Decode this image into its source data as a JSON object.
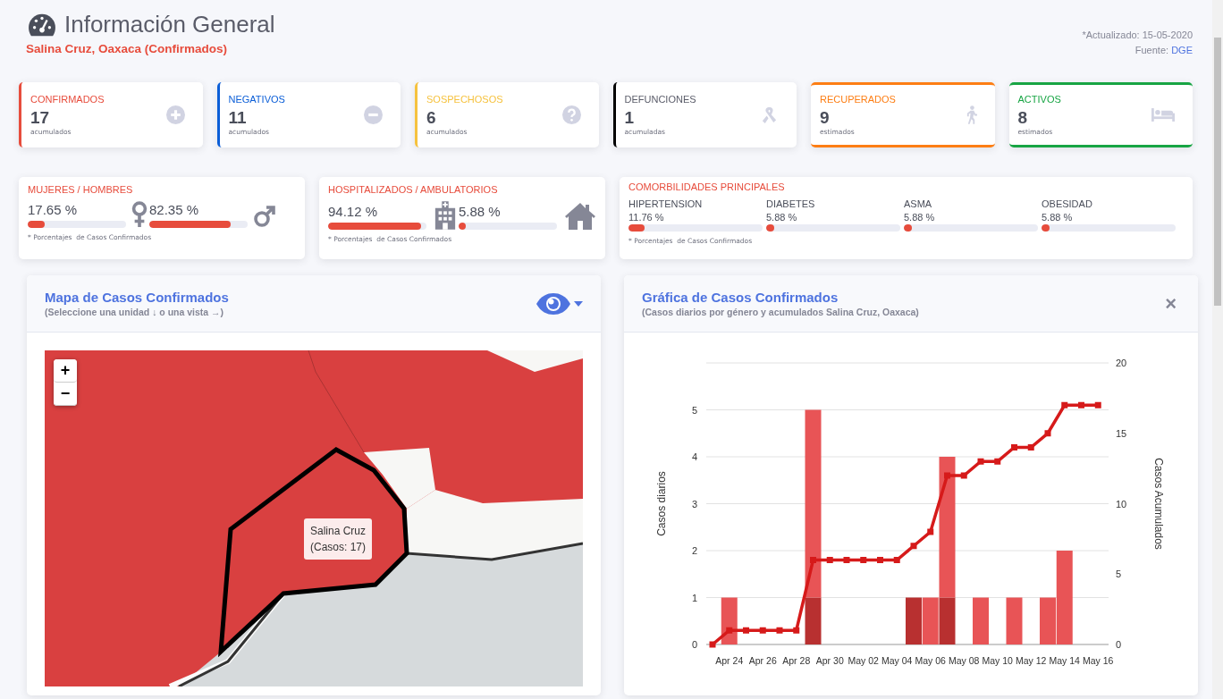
{
  "header": {
    "title": "Información General",
    "subtitle": "Salina Cruz, Oaxaca (Confirmados)",
    "updated": "*Actualizado: 15-05-2020",
    "source_label": "Fuente:",
    "source_link": "DGE"
  },
  "stats": [
    {
      "label": "CONFIRMADOS",
      "value": "17",
      "note": "acumulados",
      "kind": "left",
      "color": "#e74c3c"
    },
    {
      "label": "NEGATIVOS",
      "value": "11",
      "note": "acumulados",
      "kind": "left",
      "color": "#0b5ed7"
    },
    {
      "label": "SOSPECHOSOS",
      "value": "6",
      "note": "acumulados",
      "kind": "left",
      "color": "#f6c23e"
    },
    {
      "label": "DEFUNCIONES",
      "value": "1",
      "note": "acumuladas",
      "kind": "left",
      "color": "#000000"
    },
    {
      "label": "RECUPERADOS",
      "value": "9",
      "note": "estimados",
      "kind": "box",
      "color": "#fd7e14"
    },
    {
      "label": "ACTIVOS",
      "value": "8",
      "note": "estimados",
      "kind": "box",
      "color": "#18a544"
    }
  ],
  "ratios": [
    {
      "title": "MUJERES / HOMBRES",
      "items": [
        {
          "reading": "17.65 %",
          "level": 0.1765
        },
        {
          "reading": "82.35 %",
          "level": 0.8235
        }
      ],
      "note": "* Porcentajes  de Casos Confirmados"
    },
    {
      "title": "HOSPITALIZADOS / AMBULATORIOS",
      "items": [
        {
          "reading": "94.12 %",
          "level": 0.9412
        },
        {
          "reading": "5.88 %",
          "level": 0.0588
        }
      ],
      "note": "* Porcentajes  de Casos Confirmados"
    }
  ],
  "comorbidities": {
    "title": "COMORBILIDADES PRINCIPALES",
    "items": [
      {
        "name": "HIPERTENSION",
        "reading": "11.76 %",
        "level": 0.1176
      },
      {
        "name": "DIABETES",
        "reading": "5.88 %",
        "level": 0.0588
      },
      {
        "name": "ASMA",
        "reading": "5.88 %",
        "level": 0.0588
      },
      {
        "name": "OBESIDAD",
        "reading": "5.88 %",
        "level": 0.0588
      }
    ],
    "note": "* Porcentajes  de Casos Confirmados"
  },
  "map_panel": {
    "title": "Mapa de Casos Confirmados",
    "subtitle": "(Seleccione una unidad ↓ o una vista →)",
    "zoom_in": "+",
    "zoom_out": "−",
    "tooltip": [
      "Salina Cruz",
      "(Casos: 17)"
    ]
  },
  "chart_panel": {
    "title": "Gráfica de Casos Confirmados",
    "subtitle": "(Casos diarios por género y acumulados Salina Cruz, Oaxaca)",
    "close": "×",
    "daily": {
      "chart_data": {
        "type": "bar",
        "ylabel": "Casos diarios",
        "stacked": true,
        "grid": true,
        "categories": [
          null,
          "Apr 24",
          null,
          "Apr 26",
          null,
          "Apr 28",
          null,
          "Apr 30",
          null,
          "May 02",
          null,
          "May 04",
          null,
          "May 06",
          null,
          "May 08",
          null,
          "May 10",
          null,
          "May 12",
          null,
          "May 14",
          null,
          "May 16"
        ],
        "ylim": [
          0,
          6
        ],
        "yticks": [
          0,
          1,
          2,
          3,
          4,
          5
        ],
        "series": [
          {
            "color": "#b83030",
            "values": [
              0,
              0,
              0,
              0,
              0,
              0,
              1,
              0,
              0,
              0,
              0,
              0,
              1,
              0,
              1,
              0,
              0,
              0,
              0,
              0,
              0,
              0,
              0,
              0
            ]
          },
          {
            "color": "#e85456",
            "values": [
              0,
              1,
              0,
              0,
              0,
              0,
              4,
              0,
              0,
              0,
              0,
              0,
              0,
              1,
              3,
              0,
              1,
              0,
              1,
              0,
              1,
              2,
              0,
              0
            ]
          }
        ]
      }
    },
    "cumulative": {
      "chart_data": {
        "type": "line",
        "ylabel": "Casos Acumulados",
        "categories": [
          null,
          null,
          null,
          null,
          null,
          null,
          null,
          null,
          null,
          null,
          null,
          null,
          null,
          null,
          null,
          null,
          null,
          null,
          null,
          null,
          null,
          null,
          null,
          null
        ],
        "ylim": [
          0,
          20
        ],
        "yticks": [
          0,
          5,
          10,
          15,
          20
        ],
        "series": [
          {
            "color": "#d61a1a",
            "marker": "square",
            "values": [
              0,
              1,
              1,
              1,
              1,
              1,
              6,
              6,
              6,
              6,
              6,
              6,
              7,
              8,
              12,
              12,
              13,
              13,
              14,
              14,
              15,
              17,
              17,
              17
            ]
          }
        ]
      }
    }
  }
}
